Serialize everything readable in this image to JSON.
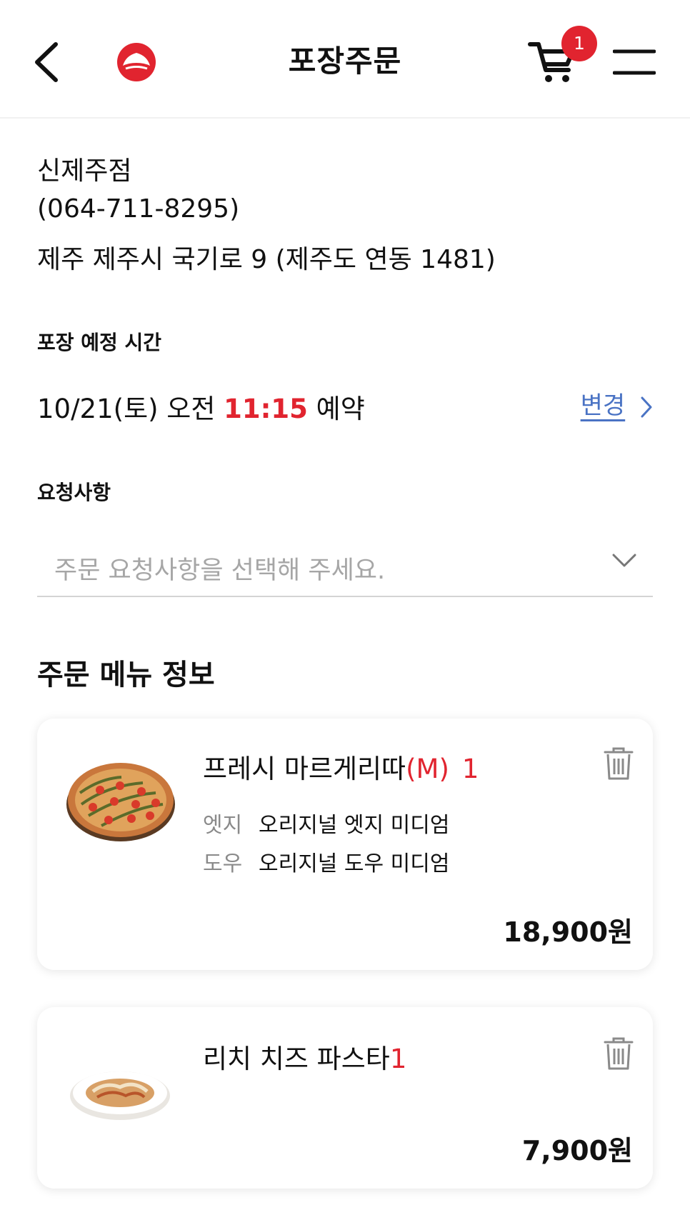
{
  "header": {
    "title": "포장주문",
    "cart_count": "1"
  },
  "store": {
    "name": "신제주점",
    "phone": "(064-711-8295)",
    "address": "제주 제주시 국기로 9 (제주도 연동 1481)"
  },
  "pickup": {
    "label": "포장 예정 시간",
    "date_prefix": "10/21(토) 오전 ",
    "time": "11:15",
    "suffix": " 예약",
    "change_label": "변경"
  },
  "request": {
    "label": "요청사항",
    "placeholder": "주문 요청사항을 선택해 주세요."
  },
  "order_section_title": "주문 메뉴 정보",
  "items": [
    {
      "name": "프레시 마르게리따",
      "size": "(M)",
      "qty": "1",
      "options": [
        {
          "key": "엣지",
          "value": "오리지널 엣지 미디엄"
        },
        {
          "key": "도우",
          "value": "오리지널 도우 미디엄"
        }
      ],
      "price": "18,900원"
    },
    {
      "name": "리치 치즈 파스타",
      "qty": "1",
      "price": "7,900원"
    }
  ],
  "colors": {
    "accent_red": "#e1242f",
    "link_blue": "#4a73c4",
    "placeholder_gray": "#a6a6a6"
  }
}
